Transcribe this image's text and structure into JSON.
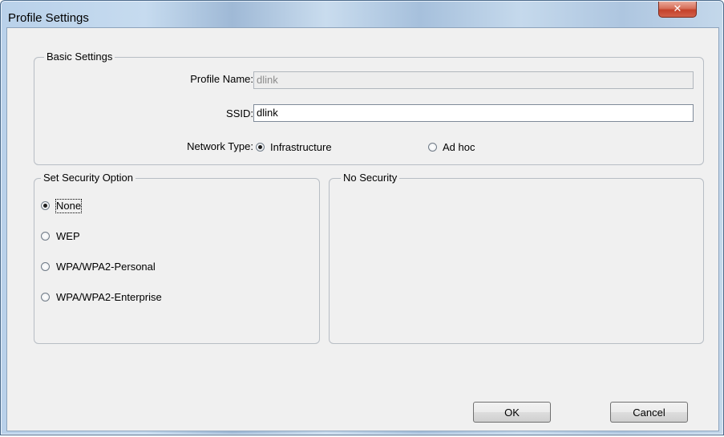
{
  "window": {
    "title": "Profile Settings",
    "close_glyph": "✕"
  },
  "basic": {
    "legend": "Basic Settings",
    "profile_name_label": "Profile Name:",
    "profile_name_value": "dlink",
    "ssid_label": "SSID:",
    "ssid_value": "dlink",
    "network_type_label": "Network Type:",
    "network_types": [
      {
        "label": "Infrastructure",
        "selected": true
      },
      {
        "label": "Ad hoc",
        "selected": false
      }
    ]
  },
  "security": {
    "legend": "Set Security Option",
    "options": [
      {
        "label": "None",
        "selected": true
      },
      {
        "label": "WEP",
        "selected": false
      },
      {
        "label": "WPA/WPA2-Personal",
        "selected": false
      },
      {
        "label": "WPA/WPA2-Enterprise",
        "selected": false
      }
    ]
  },
  "detail": {
    "legend": "No Security"
  },
  "buttons": {
    "ok": "OK",
    "cancel": "Cancel"
  },
  "colors": {
    "close_button": "#c4422b",
    "title_bar": "#b9d1ea"
  }
}
